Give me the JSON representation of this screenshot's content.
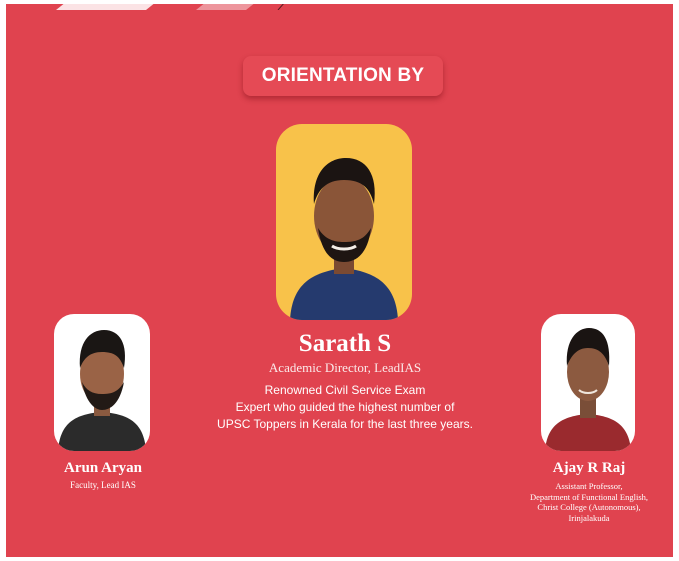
{
  "heading": "ORIENTATION BY",
  "main_speaker": {
    "name": "Sarath S",
    "title": "Academic Director, LeadIAS",
    "description_lines": [
      "Renowned Civil Service Exam",
      "Expert who guided the highest number of",
      "UPSC Toppers in Kerala for the last three years."
    ],
    "photo_bg": "#f8c24a"
  },
  "left_speaker": {
    "name": "Arun Aryan",
    "title": "Faculty, Lead IAS"
  },
  "right_speaker": {
    "name": "Ajay R Raj",
    "title_lines": [
      "Assistant Professor,",
      "Department of Functional English,",
      "Christ College (Autonomous),",
      "Irinjalakuda"
    ]
  },
  "colors": {
    "background": "#e0434f",
    "accent_yellow": "#f8c24a",
    "text": "#ffffff"
  }
}
